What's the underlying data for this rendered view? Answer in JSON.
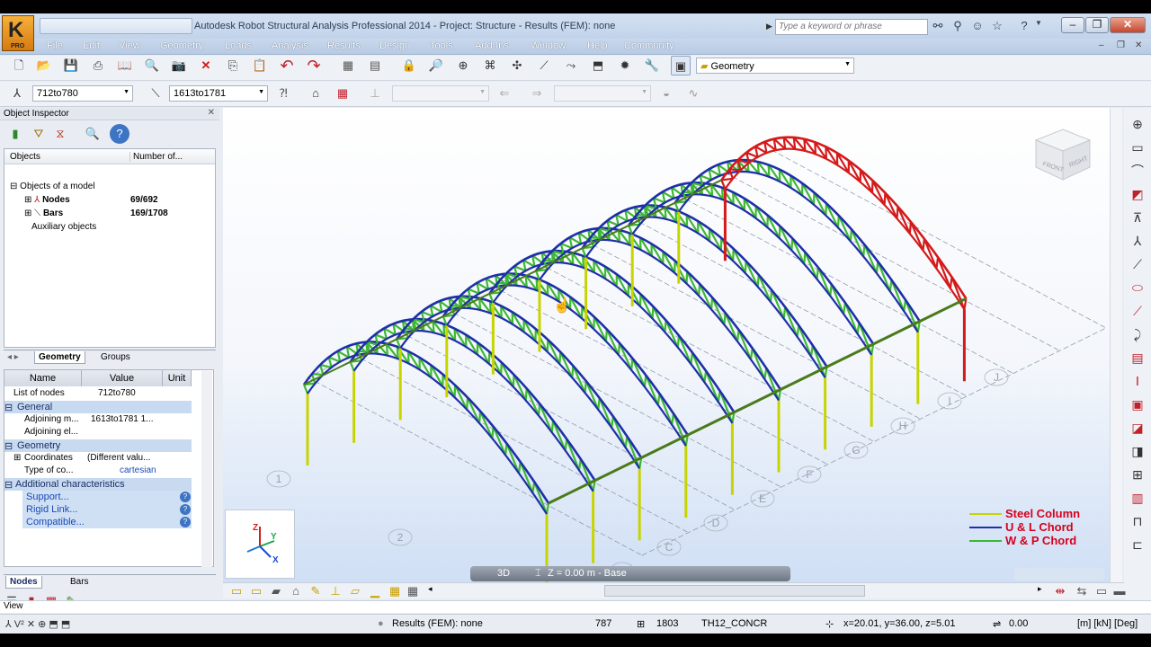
{
  "app": {
    "title": "Autodesk Robot Structural Analysis Professional 2014 - Project: Structure - Results (FEM): none",
    "logo_text": "K",
    "logo_sub": "PRO",
    "search_placeholder": "Type a keyword or phrase"
  },
  "menu": [
    "File",
    "Edit",
    "View",
    "Geometry",
    "Loads",
    "Analysis",
    "Results",
    "Design",
    "Tools",
    "Add-Ins",
    "Window",
    "Help",
    "Community"
  ],
  "toolbar": {
    "layout_select": "Geometry",
    "node_select": "712to780",
    "bar_select": "1613to1781"
  },
  "inspector": {
    "title": "Object Inspector",
    "col_objects": "Objects",
    "col_number": "Number of...",
    "root": "Objects of a model",
    "nodes_label": "Nodes",
    "nodes_count": "69/692",
    "bars_label": "Bars",
    "bars_count": "169/1708",
    "aux": "Auxiliary objects",
    "tab_geometry": "Geometry",
    "tab_groups": "Groups"
  },
  "properties": {
    "h_name": "Name",
    "h_value": "Value",
    "h_unit": "Unit",
    "list_label": "List of nodes",
    "list_value": "712to780",
    "general": "General",
    "adj_m": "Adjoining m...",
    "adj_m_val": "1613to1781 1...",
    "adj_el": "Adjoining el...",
    "geometry": "Geometry",
    "coords": "Coordinates",
    "coords_val": "(Different valu...",
    "typeco": "Type of co...",
    "typeco_val": "cartesian",
    "additional": "Additional characteristics",
    "support": "Support...",
    "rigid": "Rigid Link...",
    "compat": "Compatible..."
  },
  "bottom_tabs": {
    "nodes": "Nodes",
    "bars": "Bars"
  },
  "viewport": {
    "view_mode": "3D",
    "level": "Z = 0.00 m - Base",
    "axis_x": "X",
    "axis_y": "Y",
    "axis_z": "Z",
    "cube_front": "FRONT",
    "cube_right": "RIGHT",
    "gridlines": [
      "1",
      "2",
      "B",
      "C",
      "D",
      "E",
      "F",
      "G",
      "H",
      "I",
      "J"
    ]
  },
  "legend": [
    {
      "label": "Steel Column",
      "color": "#c8d400"
    },
    {
      "label": "U & L Chord",
      "color": "#1f2fa8"
    },
    {
      "label": "W & P Chord",
      "color": "#3cb832"
    }
  ],
  "colors": {
    "truss_chord": "#1f2fa8",
    "truss_web": "#3cb832",
    "column": "#c8d400",
    "selected": "#d41a1a"
  },
  "view_label": "View",
  "status": {
    "results": "Results (FEM): none",
    "n1": "787",
    "n2": "1803",
    "section": "TH12_CONCR",
    "coords": "x=20.01, y=36.00, z=5.01",
    "angle": "0.00",
    "units": "[m] [kN] [Deg]"
  }
}
